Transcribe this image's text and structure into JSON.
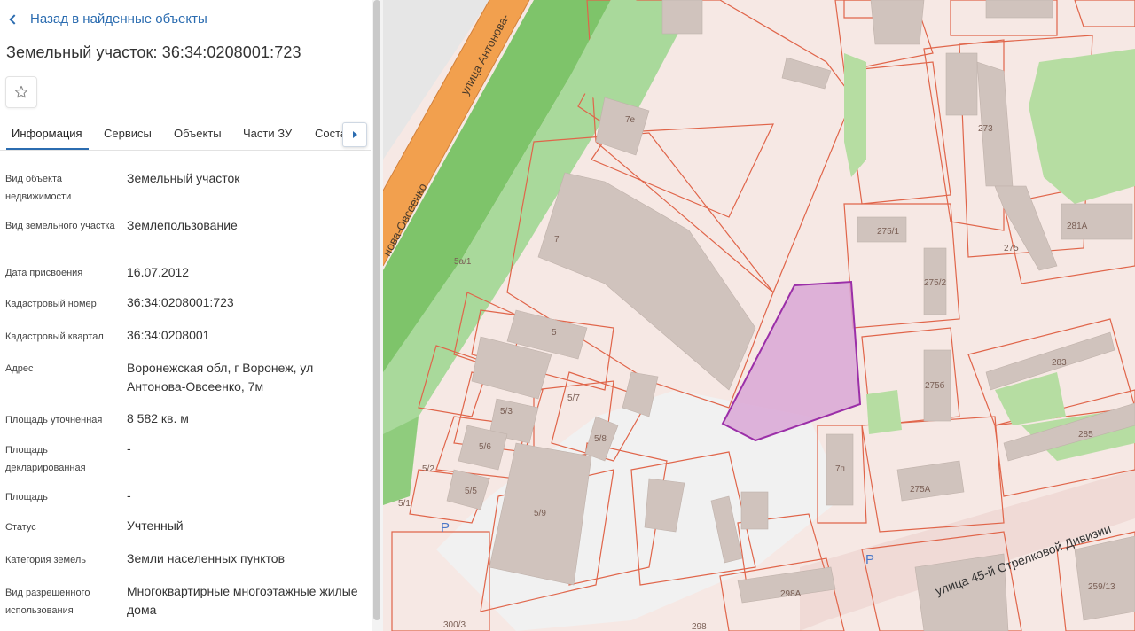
{
  "back_link": {
    "label": "Назад в найденные объекты"
  },
  "title": "Земельный участок: 36:34:0208001:723",
  "tabs": [
    {
      "label": "Информация",
      "active": true
    },
    {
      "label": "Сервисы"
    },
    {
      "label": "Объекты"
    },
    {
      "label": "Части ЗУ"
    },
    {
      "label": "Соста"
    }
  ],
  "properties": [
    {
      "label": "Вид объекта недвижимости",
      "value": "Земельный участок"
    },
    {
      "label": "Вид земельного участка",
      "value": "Землепользование"
    },
    {
      "label": "Дата присвоения",
      "value": "16.07.2012"
    },
    {
      "label": "Кадастровый номер",
      "value": "36:34:0208001:723"
    },
    {
      "label": "Кадастровый квартал",
      "value": "36:34:0208001"
    },
    {
      "label": "Адрес",
      "value": "Воронежская обл, г Воронеж, ул Антонова-Овсеенко, 7м"
    },
    {
      "label": "Площадь уточненная",
      "value": "8 582 кв. м"
    },
    {
      "label": "Площадь декларированная",
      "value": "-"
    },
    {
      "label": "Площадь",
      "value": "-"
    },
    {
      "label": "Статус",
      "value": "Учтенный"
    },
    {
      "label": "Категория земель",
      "value": "Земли населенных пунктов"
    },
    {
      "label": "Вид разрешенного использования",
      "value": "Многоквартирные многоэтажные жилые дома"
    }
  ],
  "map": {
    "streets": {
      "antonova": "улица Антонова-",
      "antonova2": "нова-Овсеенко",
      "division": "улица 45-й Стрелковой Дивизии"
    },
    "parcel_labels": [
      "7e",
      "7",
      "5а/1",
      "5",
      "5/3",
      "5/6",
      "5/5",
      "5/2",
      "5/1",
      "5/7",
      "5/8",
      "5/9",
      "273",
      "275/1",
      "275/2",
      "275",
      "281А",
      "283",
      "275б",
      "285",
      "7п",
      "275А",
      "298А",
      "298",
      "259/13",
      "300/3"
    ],
    "parking_label": "P",
    "colors": {
      "selected_fill": "#d9a7d6",
      "selected_stroke": "#9b2fa8",
      "parcel_stroke": "#e0654a",
      "building": "#d0c3bd",
      "park": "#b9e0a8",
      "road_orange": "#f3a04f"
    }
  }
}
